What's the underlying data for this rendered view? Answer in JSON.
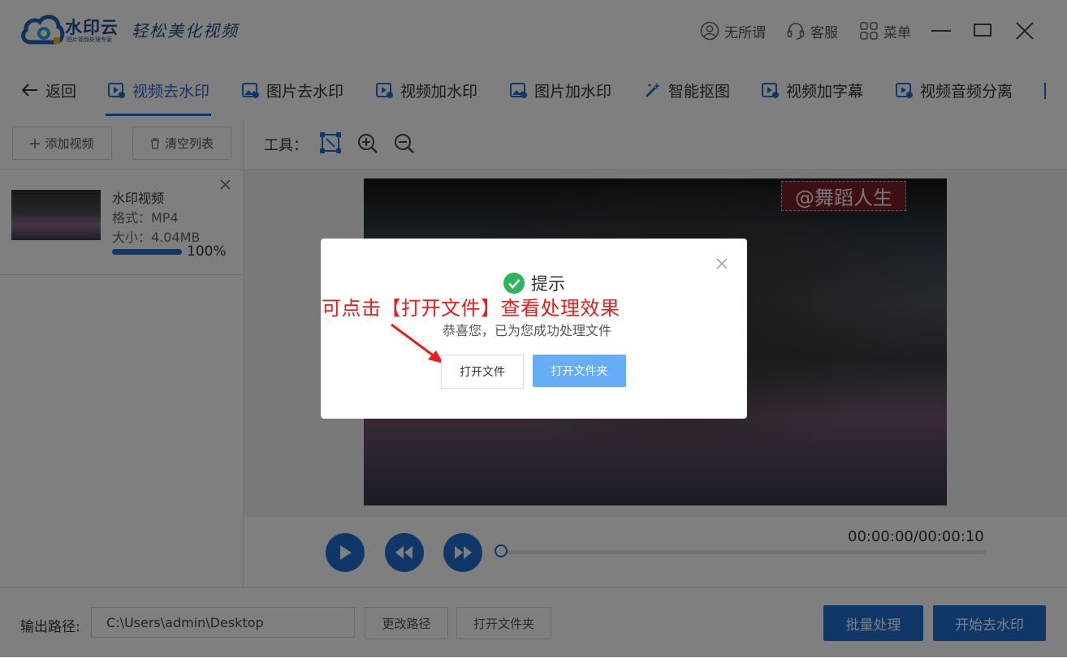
{
  "app": {
    "name": "水印云",
    "subtitle": "图片视频处理专家",
    "slogan": "轻松美化视频"
  },
  "header": {
    "user_label": "无所谓",
    "service_label": "客服",
    "menu_label": "菜单"
  },
  "nav": {
    "back_label": "返回",
    "tabs": [
      {
        "label": "视频去水印",
        "active": true
      },
      {
        "label": "图片去水印"
      },
      {
        "label": "视频加水印"
      },
      {
        "label": "图片加水印"
      },
      {
        "label": "智能抠图"
      },
      {
        "label": "视频加字幕"
      },
      {
        "label": "视频音频分离"
      }
    ]
  },
  "sidebar": {
    "add_video_label": "添加视频",
    "clear_list_label": "清空列表",
    "file": {
      "name": "水印视频",
      "format": "格式：MP4",
      "size": "大小：4.04MB",
      "progress_label": "100%",
      "progress": 1.0
    }
  },
  "toolbar": {
    "tools_label": "工具："
  },
  "preview": {
    "watermark_text": "@舞蹈人生"
  },
  "player": {
    "timecode": "00:00:00/00:00:10",
    "progress": 0
  },
  "bottom": {
    "output_label": "输出路径:",
    "output_path": "C:\\Users\\admin\\Desktop",
    "change_path_label": "更改路径",
    "open_folder_label": "打开文件夹",
    "batch_label": "批量处理",
    "start_label": "开始去水印"
  },
  "dialog": {
    "title": "提示",
    "message": "恭喜您，已为您成功处理文件",
    "open_file_label": "打开文件",
    "open_folder_label": "打开文件夹",
    "annotation": "可点击【打开文件】查看处理效果"
  },
  "colors": {
    "accent": "#1f6fd1",
    "success": "#2db55d",
    "annotation": "#ee1c1c",
    "dialog_button": "#66acf7"
  }
}
